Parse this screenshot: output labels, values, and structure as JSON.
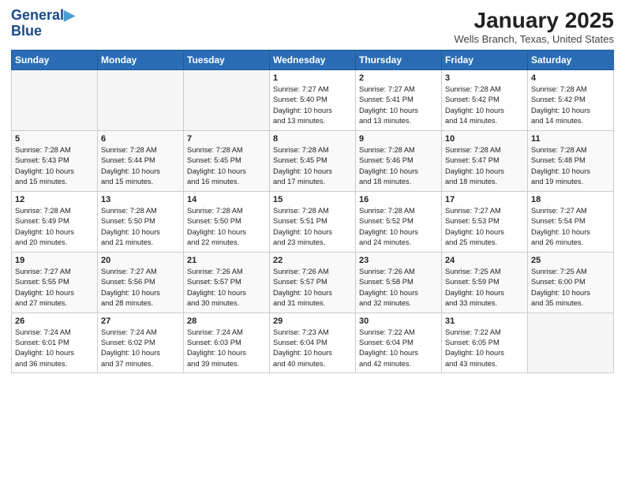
{
  "logo": {
    "line1": "General",
    "line2": "Blue"
  },
  "title": "January 2025",
  "subtitle": "Wells Branch, Texas, United States",
  "headers": [
    "Sunday",
    "Monday",
    "Tuesday",
    "Wednesday",
    "Thursday",
    "Friday",
    "Saturday"
  ],
  "weeks": [
    [
      {
        "day": "",
        "info": ""
      },
      {
        "day": "",
        "info": ""
      },
      {
        "day": "",
        "info": ""
      },
      {
        "day": "1",
        "info": "Sunrise: 7:27 AM\nSunset: 5:40 PM\nDaylight: 10 hours\nand 13 minutes."
      },
      {
        "day": "2",
        "info": "Sunrise: 7:27 AM\nSunset: 5:41 PM\nDaylight: 10 hours\nand 13 minutes."
      },
      {
        "day": "3",
        "info": "Sunrise: 7:28 AM\nSunset: 5:42 PM\nDaylight: 10 hours\nand 14 minutes."
      },
      {
        "day": "4",
        "info": "Sunrise: 7:28 AM\nSunset: 5:42 PM\nDaylight: 10 hours\nand 14 minutes."
      }
    ],
    [
      {
        "day": "5",
        "info": "Sunrise: 7:28 AM\nSunset: 5:43 PM\nDaylight: 10 hours\nand 15 minutes."
      },
      {
        "day": "6",
        "info": "Sunrise: 7:28 AM\nSunset: 5:44 PM\nDaylight: 10 hours\nand 15 minutes."
      },
      {
        "day": "7",
        "info": "Sunrise: 7:28 AM\nSunset: 5:45 PM\nDaylight: 10 hours\nand 16 minutes."
      },
      {
        "day": "8",
        "info": "Sunrise: 7:28 AM\nSunset: 5:45 PM\nDaylight: 10 hours\nand 17 minutes."
      },
      {
        "day": "9",
        "info": "Sunrise: 7:28 AM\nSunset: 5:46 PM\nDaylight: 10 hours\nand 18 minutes."
      },
      {
        "day": "10",
        "info": "Sunrise: 7:28 AM\nSunset: 5:47 PM\nDaylight: 10 hours\nand 18 minutes."
      },
      {
        "day": "11",
        "info": "Sunrise: 7:28 AM\nSunset: 5:48 PM\nDaylight: 10 hours\nand 19 minutes."
      }
    ],
    [
      {
        "day": "12",
        "info": "Sunrise: 7:28 AM\nSunset: 5:49 PM\nDaylight: 10 hours\nand 20 minutes."
      },
      {
        "day": "13",
        "info": "Sunrise: 7:28 AM\nSunset: 5:50 PM\nDaylight: 10 hours\nand 21 minutes."
      },
      {
        "day": "14",
        "info": "Sunrise: 7:28 AM\nSunset: 5:50 PM\nDaylight: 10 hours\nand 22 minutes."
      },
      {
        "day": "15",
        "info": "Sunrise: 7:28 AM\nSunset: 5:51 PM\nDaylight: 10 hours\nand 23 minutes."
      },
      {
        "day": "16",
        "info": "Sunrise: 7:28 AM\nSunset: 5:52 PM\nDaylight: 10 hours\nand 24 minutes."
      },
      {
        "day": "17",
        "info": "Sunrise: 7:27 AM\nSunset: 5:53 PM\nDaylight: 10 hours\nand 25 minutes."
      },
      {
        "day": "18",
        "info": "Sunrise: 7:27 AM\nSunset: 5:54 PM\nDaylight: 10 hours\nand 26 minutes."
      }
    ],
    [
      {
        "day": "19",
        "info": "Sunrise: 7:27 AM\nSunset: 5:55 PM\nDaylight: 10 hours\nand 27 minutes."
      },
      {
        "day": "20",
        "info": "Sunrise: 7:27 AM\nSunset: 5:56 PM\nDaylight: 10 hours\nand 28 minutes."
      },
      {
        "day": "21",
        "info": "Sunrise: 7:26 AM\nSunset: 5:57 PM\nDaylight: 10 hours\nand 30 minutes."
      },
      {
        "day": "22",
        "info": "Sunrise: 7:26 AM\nSunset: 5:57 PM\nDaylight: 10 hours\nand 31 minutes."
      },
      {
        "day": "23",
        "info": "Sunrise: 7:26 AM\nSunset: 5:58 PM\nDaylight: 10 hours\nand 32 minutes."
      },
      {
        "day": "24",
        "info": "Sunrise: 7:25 AM\nSunset: 5:59 PM\nDaylight: 10 hours\nand 33 minutes."
      },
      {
        "day": "25",
        "info": "Sunrise: 7:25 AM\nSunset: 6:00 PM\nDaylight: 10 hours\nand 35 minutes."
      }
    ],
    [
      {
        "day": "26",
        "info": "Sunrise: 7:24 AM\nSunset: 6:01 PM\nDaylight: 10 hours\nand 36 minutes."
      },
      {
        "day": "27",
        "info": "Sunrise: 7:24 AM\nSunset: 6:02 PM\nDaylight: 10 hours\nand 37 minutes."
      },
      {
        "day": "28",
        "info": "Sunrise: 7:24 AM\nSunset: 6:03 PM\nDaylight: 10 hours\nand 39 minutes."
      },
      {
        "day": "29",
        "info": "Sunrise: 7:23 AM\nSunset: 6:04 PM\nDaylight: 10 hours\nand 40 minutes."
      },
      {
        "day": "30",
        "info": "Sunrise: 7:22 AM\nSunset: 6:04 PM\nDaylight: 10 hours\nand 42 minutes."
      },
      {
        "day": "31",
        "info": "Sunrise: 7:22 AM\nSunset: 6:05 PM\nDaylight: 10 hours\nand 43 minutes."
      },
      {
        "day": "",
        "info": ""
      }
    ]
  ]
}
